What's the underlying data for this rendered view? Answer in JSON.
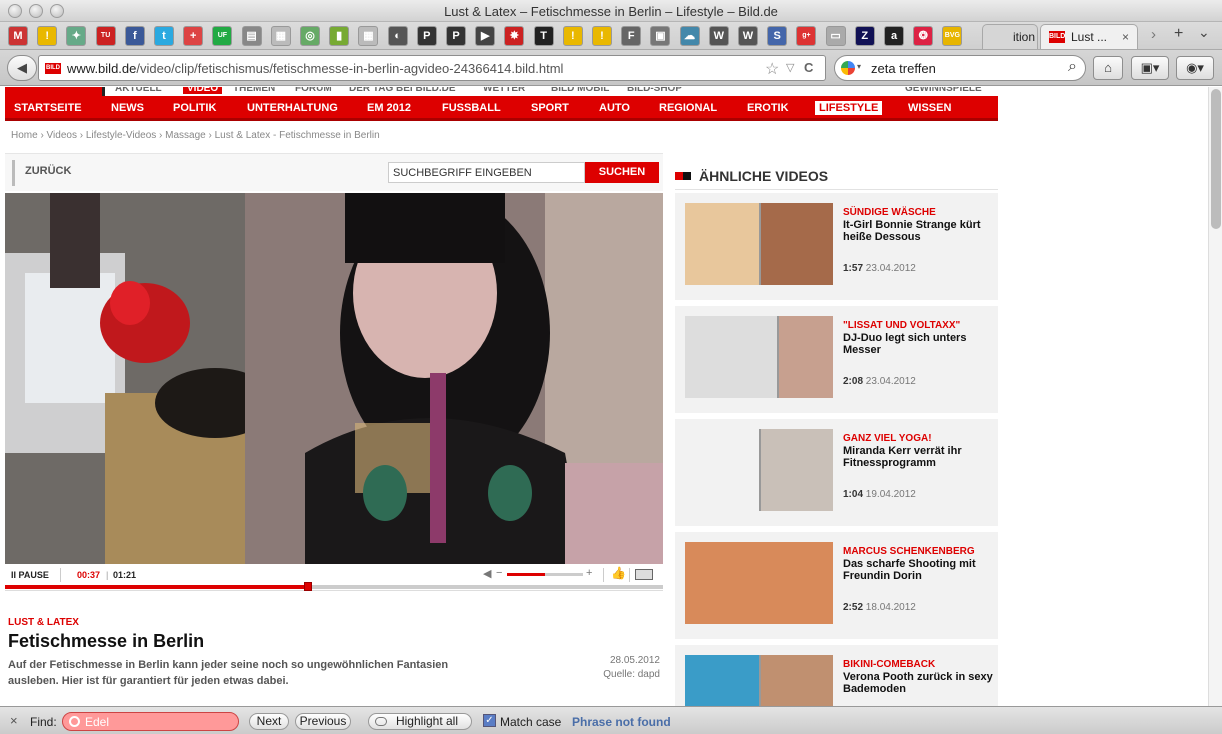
{
  "window": {
    "title": "Lust & Latex – Fetischmesse in Berlin – Lifestyle – Bild.de"
  },
  "bookmarks": {
    "icons": [
      "gmail-icon",
      "warning-icon",
      "puzzle-icon",
      "tu-icon",
      "facebook-icon",
      "twitter-icon",
      "plus-icon",
      "uf-icon",
      "doc-icon",
      "dotted-icon",
      "globe-icon",
      "bookmark-icon",
      "dotted-icon",
      "spiral-icon",
      "p-icon",
      "p-icon",
      "play-icon",
      "star-icon",
      "t-icon",
      "warning-icon",
      "warning-icon",
      "frame-icon",
      "news-icon",
      "cloud-icon",
      "wikipedia-icon",
      "wikipedia-icon",
      "s-icon",
      "google-plus-icon",
      "flag-icon",
      "z-icon",
      "amazon-icon",
      "spiral-icon",
      "bvg-icon"
    ]
  },
  "tabs": [
    {
      "label": "ition ...",
      "favicon": ""
    },
    {
      "label": "Lust ...",
      "favicon": "BILD",
      "close": "×"
    }
  ],
  "tabbar": {
    "next": "›",
    "new_tab": "+",
    "menu": "⌄"
  },
  "navbar": {
    "back": "◀",
    "url_domain": "www.bild.de",
    "url_path": "/video/clip/fetischismus/fetischmesse-in-berlin-agvideo-24366414.bild.html",
    "star": "☆",
    "dropdown": "▽",
    "reload": "C",
    "search_value": "zeta treffen",
    "search_icon": "⌕",
    "home": "⌂"
  },
  "site": {
    "top_nav": [
      "AKTUELL",
      "VIDEO",
      "THEMEN",
      "FORUM",
      "DER TAG BEI BILD.DE",
      "WETTER",
      "BILD MOBIL",
      "BILD-SHOP",
      "GEWINNSPIELE"
    ],
    "red_nav": [
      "STARTSEITE",
      "NEWS",
      "POLITIK",
      "UNTERHALTUNG",
      "EM 2012",
      "FUSSBALL",
      "SPORT",
      "AUTO",
      "REGIONAL",
      "EROTIK",
      "LIFESTYLE",
      "WISSEN"
    ],
    "breadcrumb": "Home › Videos › Lifestyle-Videos › Massage › Lust & Latex - Fetischmesse in Berlin",
    "back_label": "ZURÜCK",
    "search_placeholder": "SUCHBEGRIFF EINGEBEN",
    "search_button": "SUCHEN"
  },
  "player": {
    "pause_label": "PAUSE",
    "current_time": "00:37",
    "separator": "|",
    "duration": "01:21",
    "progress_fraction": 0.46,
    "volume_fraction": 0.5,
    "volume_minus": "−",
    "volume_plus": "+"
  },
  "article": {
    "kicker": "LUST & LATEX",
    "title": "Fetischmesse in Berlin",
    "description": "Auf der Fetischmesse in Berlin kann jeder seine noch so ungewöhnlichen Fantasien ausleben. Hier ist für garantiert für jeden etwas dabei.",
    "date": "28.05.2012",
    "source": "Quelle: dapd"
  },
  "sidebar": {
    "heading": "ÄHNLICHE VIDEOS",
    "videos": [
      {
        "kicker": "SÜNDIGE WÄSCHE",
        "title": "It-Girl Bonnie Strange kürt heiße Dessous",
        "duration": "1:57",
        "date": "23.04.2012"
      },
      {
        "kicker": "\"LISSAT UND VOLTAXX\"",
        "title": "DJ-Duo legt sich unters Messer",
        "duration": "2:08",
        "date": "23.04.2012"
      },
      {
        "kicker": "GANZ VIEL YOGA!",
        "title": "Miranda Kerr verrät ihr Fitnessprogramm",
        "duration": "1:04",
        "date": "19.04.2012"
      },
      {
        "kicker": "MARCUS SCHENKENBERG",
        "title": "Das scharfe Shooting mit Freundin Dorin",
        "duration": "2:52",
        "date": "18.04.2012"
      },
      {
        "kicker": "BIKINI-COMEBACK",
        "title": "Verona Pooth zurück in sexy Bademoden",
        "duration": "",
        "date": ""
      }
    ]
  },
  "findbar": {
    "close": "×",
    "label": "Find:",
    "value": "Edel",
    "next": "Next",
    "previous": "Previous",
    "highlight": "Highlight all",
    "match_case": "Match case",
    "match_case_checked": true,
    "status": "Phrase not found"
  },
  "colors": {
    "brand": "#dd0000",
    "find_not_found": "#ff9999",
    "status_text": "#4a6ea8"
  }
}
